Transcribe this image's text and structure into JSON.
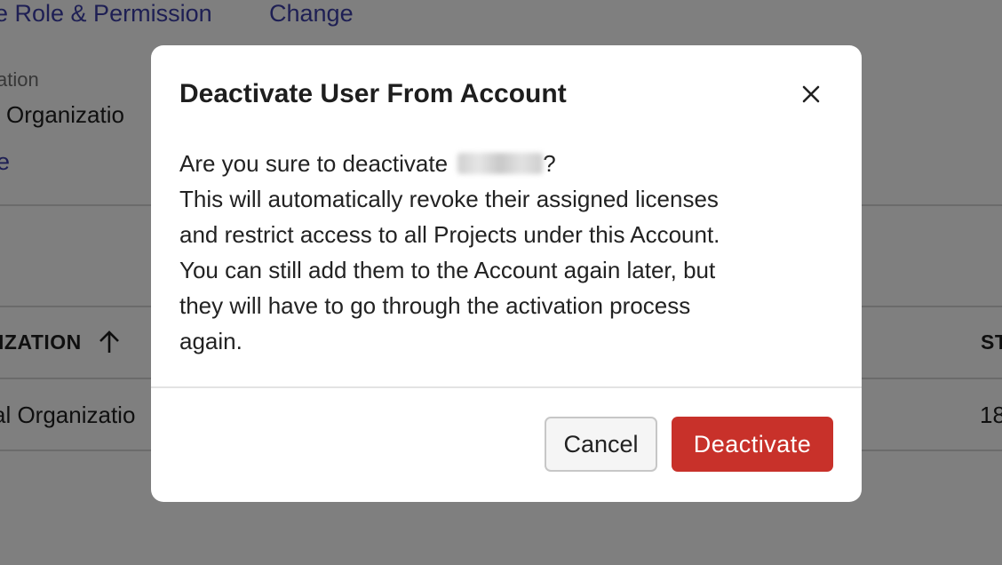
{
  "background": {
    "top_links": [
      "e Role & Permission",
      "Change"
    ],
    "org_label": "ation",
    "org_value": "l Organizatio",
    "edit_link": "e",
    "table": {
      "header_org": "IZATION",
      "header_right": "ST",
      "row_org": "al Organizatio",
      "row_right": "18"
    }
  },
  "modal": {
    "title": "Deactivate User From Account",
    "body_prefix": "Are you sure to deactivate ",
    "body_suffix": "?",
    "body_lines": [
      "This will automatically revoke their assigned licenses",
      "and restrict access to all Projects under this Account.",
      "You can still add them to the Account again later, but",
      "they will have to go through the activation process",
      "again."
    ],
    "cancel_label": "Cancel",
    "deactivate_label": "Deactivate"
  },
  "colors": {
    "link": "#3c3fa8",
    "danger": "#c8312a",
    "overlay": "rgba(0,0,0,0.5)"
  },
  "icons": {
    "sort": "arrow-up-icon",
    "close": "close-icon"
  }
}
